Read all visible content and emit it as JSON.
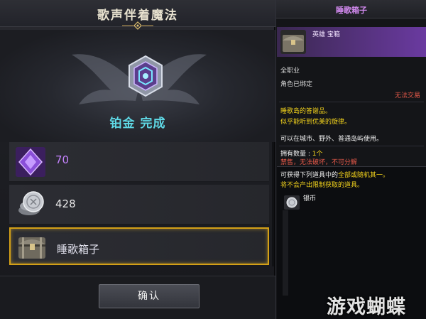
{
  "quest_panel": {
    "title": "歌声伴着魔法",
    "completion_text": "铂金 完成",
    "confirm_label": "确认",
    "rewards": [
      {
        "icon": "purple-crystal-icon",
        "label": "70"
      },
      {
        "icon": "silver-coin-icon",
        "label": "428"
      },
      {
        "icon": "treasure-chest-icon",
        "label": "睡歌箱子",
        "selected": true
      }
    ]
  },
  "item_tooltip": {
    "title": "睡歌箱子",
    "grade": "英雄 宝箱",
    "job": "全职业",
    "binding": "角色已绑定",
    "trade": "无法交易",
    "desc_line1": "睡歌岛的答谢品。",
    "desc_line2": "似乎能听到优美的旋律。",
    "usage": "可以在城市、野外、普通岛屿使用。",
    "owned_label": "拥有数量 : ",
    "owned_value": "1个",
    "restrictions": "禁售，无法破坏，不可分解",
    "box_line1_a": "可获得下列道具中的",
    "box_line1_b": "全部或随机其一。",
    "box_line2": "将不会产出限制获取的道具。",
    "box_item": "银币"
  },
  "watermark": "游戏蝴蝶",
  "colors": {
    "accent_cyan": "#5fd9e6",
    "selected_border": "#d4a017",
    "hero_purple": "#c583ff",
    "warning_red": "#e85a4a"
  }
}
